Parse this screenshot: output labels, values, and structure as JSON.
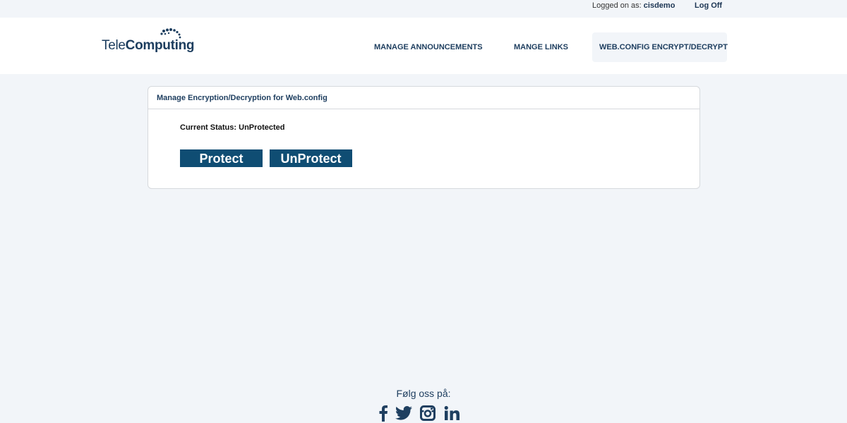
{
  "topbar": {
    "logged_prefix": "Logged on as:",
    "username": "cisdemo",
    "logoff": "Log Off"
  },
  "logo": {
    "light": "Tele",
    "bold": "Computing"
  },
  "nav": {
    "items": [
      {
        "label": "MANAGE ANNOUNCEMENTS"
      },
      {
        "label": "MANGE LINKS"
      },
      {
        "label": "WEB.CONFIG ENCRYPT/DECRYPT",
        "active": true
      }
    ]
  },
  "panel": {
    "title": "Manage Encryption/Decryption for Web.config",
    "status_label": "Current Status:",
    "status_value": "UnProtected",
    "protect_button": "Protect",
    "unprotect_button": "UnProtect"
  },
  "footer": {
    "follow_label": "Følg oss på:",
    "social_icons": [
      "facebook-icon",
      "twitter-icon",
      "instagram-icon",
      "linkedin-icon"
    ]
  },
  "colors": {
    "brand": "#1f3f60",
    "button": "#0f4d73",
    "background": "#f2f5f9"
  }
}
